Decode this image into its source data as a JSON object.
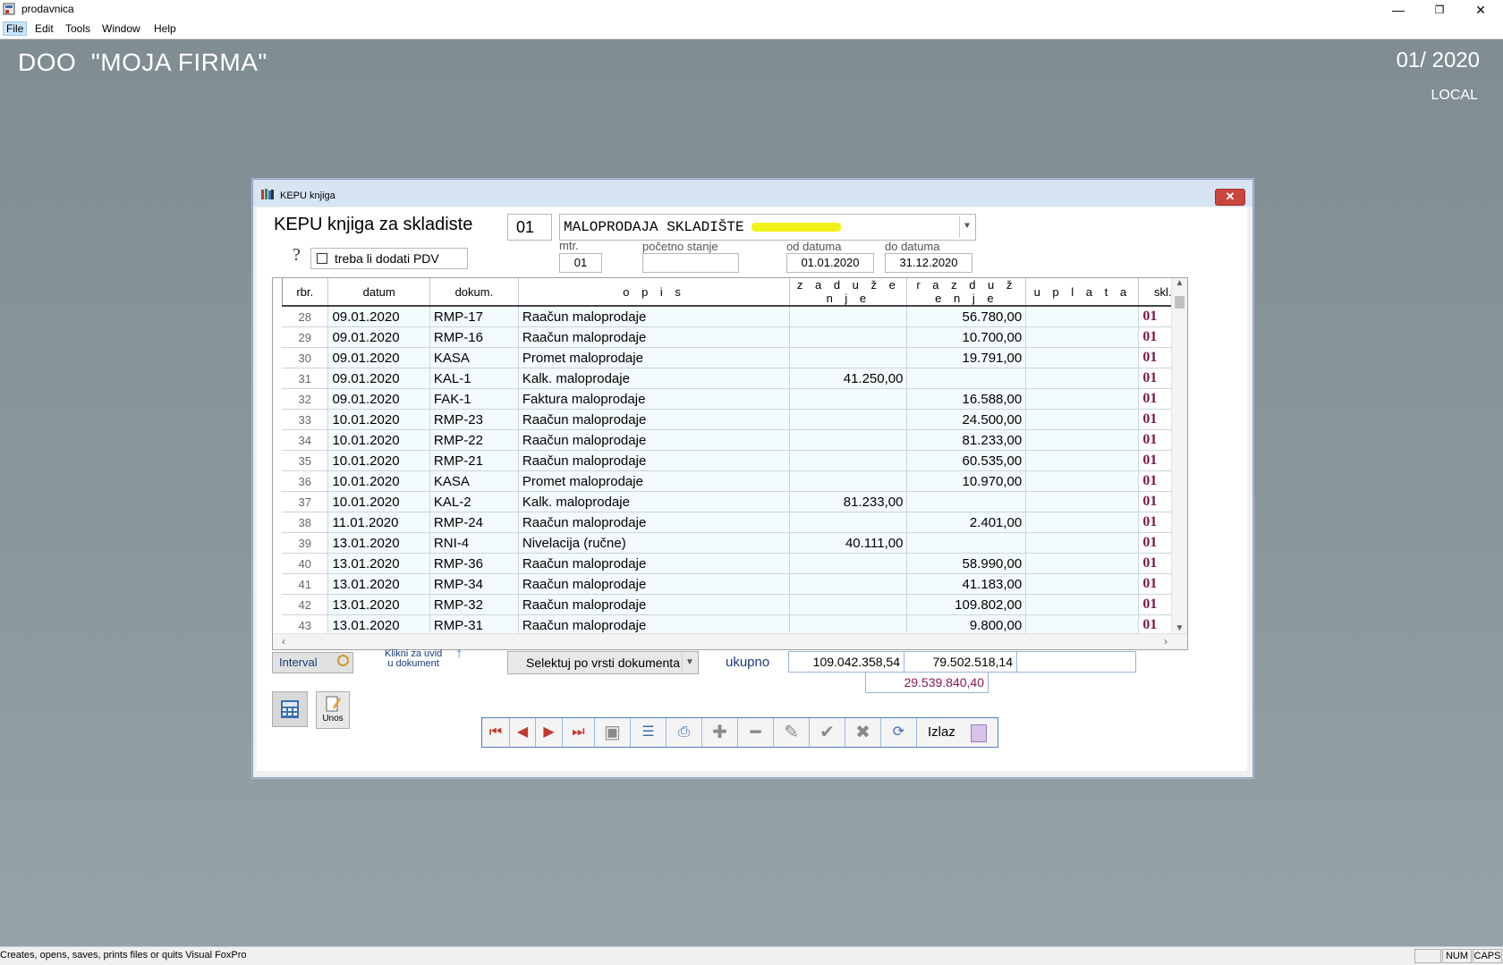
{
  "app": {
    "title": "prodavnica",
    "minimize": "—",
    "restore": "❐",
    "close": "✕"
  },
  "menu": [
    "File",
    "Edit",
    "Tools",
    "Window",
    "Help"
  ],
  "desktop": {
    "company": "DOO  \"MOJA FIRMA\"",
    "period": "01/ 2020",
    "server": "LOCAL"
  },
  "dialog": {
    "title": "KEPU knjiga",
    "close": "✕",
    "header_title": "KEPU knjiga za skladiste",
    "skl_code": "01",
    "skl_name": "MALOPRODAJA SKLADIŠTE",
    "question": "?",
    "pdv_label": "treba li dodati PDV",
    "mtr_label": "mtr.",
    "mtr_value": "01",
    "pocetno_label": "početno stanje",
    "pocetno_value": "",
    "od_label": "od datuma",
    "od_value": "01.01.2020",
    "do_label": "do datuma",
    "do_value": "31.12.2020"
  },
  "grid": {
    "columns": [
      "rbr.",
      "datum",
      "dokum.",
      "o p i s",
      "z a d u ž e n j e",
      "r a z d u ž e n j e",
      "u p l a t a",
      "skl."
    ],
    "rows": [
      [
        "28",
        "09.01.2020",
        "RMP-17",
        "Raačun maloprodaje",
        "",
        "56.780,00",
        "",
        "01"
      ],
      [
        "29",
        "09.01.2020",
        "RMP-16",
        "Raačun maloprodaje",
        "",
        "10.700,00",
        "",
        "01"
      ],
      [
        "30",
        "09.01.2020",
        "KASA",
        "Promet maloprodaje",
        "",
        "19.791,00",
        "",
        "01"
      ],
      [
        "31",
        "09.01.2020",
        "KAL-1",
        "Kalk. maloprodaje",
        "41.250,00",
        "",
        "",
        "01"
      ],
      [
        "32",
        "09.01.2020",
        "FAK-1",
        "Faktura maloprodaje",
        "",
        "16.588,00",
        "",
        "01"
      ],
      [
        "33",
        "10.01.2020",
        "RMP-23",
        "Raačun maloprodaje",
        "",
        "24.500,00",
        "",
        "01"
      ],
      [
        "34",
        "10.01.2020",
        "RMP-22",
        "Raačun maloprodaje",
        "",
        "81.233,00",
        "",
        "01"
      ],
      [
        "35",
        "10.01.2020",
        "RMP-21",
        "Raačun maloprodaje",
        "",
        "60.535,00",
        "",
        "01"
      ],
      [
        "36",
        "10.01.2020",
        "KASA",
        "Promet maloprodaje",
        "",
        "10.970,00",
        "",
        "01"
      ],
      [
        "37",
        "10.01.2020",
        "KAL-2",
        "Kalk. maloprodaje",
        "81.233,00",
        "",
        "",
        "01"
      ],
      [
        "38",
        "11.01.2020",
        "RMP-24",
        "Raačun maloprodaje",
        "",
        "2.401,00",
        "",
        "01"
      ],
      [
        "39",
        "13.01.2020",
        "RNI-4",
        "Nivelacija (ručne)",
        "40.111,00",
        "",
        "",
        "01"
      ],
      [
        "40",
        "13.01.2020",
        "RMP-36",
        "Raačun maloprodaje",
        "",
        "58.990,00",
        "",
        "01"
      ],
      [
        "41",
        "13.01.2020",
        "RMP-34",
        "Raačun maloprodaje",
        "",
        "41.183,00",
        "",
        "01"
      ],
      [
        "42",
        "13.01.2020",
        "RMP-32",
        "Raačun maloprodaje",
        "",
        "109.802,00",
        "",
        "01"
      ],
      [
        "43",
        "13.01.2020",
        "RMP-31",
        "Raačun maloprodaje",
        "",
        "9.800,00",
        "",
        "01"
      ]
    ]
  },
  "footer": {
    "interval": "Interval",
    "klik_line1": "Klikni za uvid",
    "klik_line2": "u dokument",
    "selektuj": "Selektuj po vrsti dokumenta",
    "ukupno": "ukupno",
    "total_zaduzenje": "109.042.358,54",
    "total_razduzenje": "79.502.518,14",
    "total_uplata": "",
    "difference": "29.539.840,40",
    "unos": "Unos",
    "izlaz": "Izlaz"
  },
  "status": {
    "text": "Creates, opens, saves, prints files or quits Visual FoxPro",
    "num": "NUM",
    "caps": "CAPS"
  },
  "icons": {
    "first": "first-record-icon",
    "prev": "previous-record-icon",
    "next": "next-record-icon",
    "last": "last-record-icon",
    "new": "new-document-icon",
    "details": "details-icon",
    "print": "printer-icon",
    "add": "add-icon",
    "remove": "remove-icon",
    "edit": "edit-icon",
    "ok": "confirm-icon",
    "cancel": "cancel-icon",
    "refresh": "refresh-icon",
    "exit": "exit-door-icon"
  }
}
